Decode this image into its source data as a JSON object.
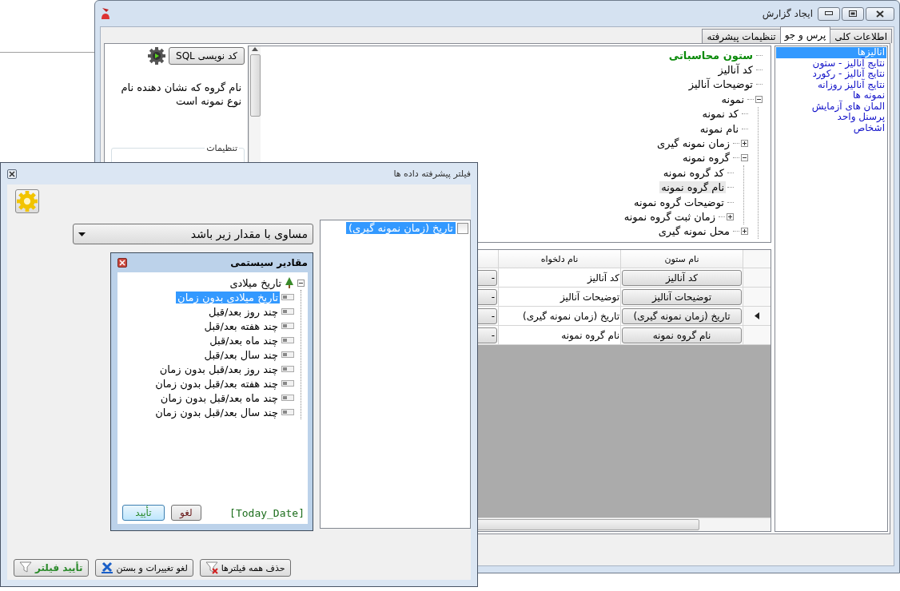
{
  "window": {
    "title": "ایجاد گزارش"
  },
  "tabs": [
    {
      "label": "اطلاعات کلی",
      "selected": false
    },
    {
      "label": "پرس و جو",
      "selected": true
    },
    {
      "label": "تنظیمات پیشرفته",
      "selected": false
    }
  ],
  "source_list": [
    {
      "label": "آنالیزها",
      "selected": true
    },
    {
      "label": "نتایج آنالیز - ستون",
      "selected": false
    },
    {
      "label": "نتایج آنالیز - رکورد",
      "selected": false
    },
    {
      "label": "نتایج آنالیز روزانه",
      "selected": false
    },
    {
      "label": "نمونه ها",
      "selected": false
    },
    {
      "label": "المان های آزمایش",
      "selected": false
    },
    {
      "label": "پرسنل واحد",
      "selected": false
    },
    {
      "label": "اشخاص",
      "selected": false
    }
  ],
  "sql_button": {
    "label": "کد نویسی SQL"
  },
  "description": "نام گروه که نشان دهنده نام نوع نمونه است",
  "settings_group": {
    "title": "تنظیمات"
  },
  "column_tree": [
    {
      "label": "ستون محاسباتی",
      "kind": "computed",
      "selected": false
    },
    {
      "label": "کد آنالیز",
      "kind": "column",
      "selected": false
    },
    {
      "label": "توضیحات آنالیز",
      "kind": "column",
      "selected": false
    },
    {
      "label": "نمونه",
      "kind": "column",
      "selected": false,
      "expanded": true,
      "children": [
        {
          "label": "کد نمونه",
          "kind": "column",
          "selected": false
        },
        {
          "label": "نام نمونه",
          "kind": "column",
          "selected": false
        },
        {
          "label": "زمان نمونه گیری",
          "kind": "column",
          "selected": false,
          "expanded": false
        },
        {
          "label": "گروه نمونه",
          "kind": "column",
          "selected": false,
          "expanded": true,
          "children": [
            {
              "label": "کد گروه نمونه",
              "kind": "column",
              "selected": false
            },
            {
              "label": "نام گروه نمونه",
              "kind": "column",
              "selected": true
            },
            {
              "label": "توضیحات گروه نمونه",
              "kind": "column",
              "selected": false
            },
            {
              "label": "زمان ثبت گروه نمونه",
              "kind": "column",
              "selected": false,
              "expanded": false
            }
          ]
        },
        {
          "label": "محل نمونه گیری",
          "kind": "column",
          "selected": false,
          "expanded": false
        }
      ]
    }
  ],
  "column_table": {
    "columns": [
      "نام ستون",
      "نام دلخواه"
    ],
    "rows": [
      {
        "column_name": "کد آنالیز",
        "custom_name": "کد آنالیز",
        "action": "-",
        "current": false
      },
      {
        "column_name": "توضیحات آنالیز",
        "custom_name": "توضیحات آنالیز",
        "action": "-",
        "current": false
      },
      {
        "column_name": "تاریخ (زمان نمونه گیری)",
        "custom_name": "تاریخ (زمان نمونه گیری)",
        "action": "-",
        "current": true
      },
      {
        "column_name": "نام گروه نمونه",
        "custom_name": "نام گروه نمونه",
        "action": "-",
        "current": false
      }
    ]
  },
  "filter_dialog": {
    "title": "فیلتر پیشرفته داده ها",
    "operator": "مساوی با مقدار زیر باشد",
    "fields": [
      {
        "label": "تاریخ (زمان نمونه گیری)",
        "checked": false,
        "selected": true
      }
    ],
    "system_values": {
      "title": "مقادیر سیستمی",
      "tree": [
        {
          "label": "تاریخ میلادی",
          "kind": "group",
          "selected": false,
          "expanded": true,
          "children": [
            {
              "label": "تاریخ میلادی بدون زمان",
              "kind": "value",
              "selected": true
            },
            {
              "label": "چند روز بعد/قبل",
              "kind": "value",
              "selected": false
            },
            {
              "label": "چند هفته بعد/قبل",
              "kind": "value",
              "selected": false
            },
            {
              "label": "چند ماه بعد/قبل",
              "kind": "value",
              "selected": false
            },
            {
              "label": "چند سال بعد/قبل",
              "kind": "value",
              "selected": false
            },
            {
              "label": "چند روز بعد/قبل بدون زمان",
              "kind": "value",
              "selected": false
            },
            {
              "label": "چند هفته بعد/قبل بدون زمان",
              "kind": "value",
              "selected": false
            },
            {
              "label": "چند ماه بعد/قبل بدون زمان",
              "kind": "value",
              "selected": false
            },
            {
              "label": "چند سال بعد/قبل بدون زمان",
              "kind": "value",
              "selected": false
            }
          ]
        }
      ],
      "value": "[Today_Date]",
      "buttons": [
        {
          "label": "لغو",
          "kind": "cancel"
        },
        {
          "label": "تأیید",
          "kind": "ok"
        }
      ]
    },
    "buttons": [
      {
        "label": "حذف همه فیلترها",
        "kind": "clear"
      },
      {
        "label": "لغو تغییرات و بستن",
        "kind": "close"
      },
      {
        "label": "تأیید فیلتر",
        "kind": "apply"
      }
    ]
  }
}
